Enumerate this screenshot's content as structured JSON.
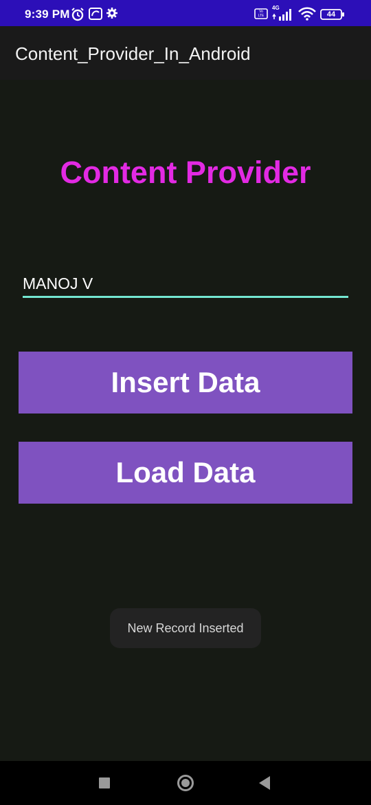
{
  "status_bar": {
    "time": "9:39 PM",
    "volte": "Vo LTE",
    "network": "4G",
    "battery": "44",
    "icons": [
      "alarm-icon",
      "hotstar-icon",
      "gear-icon",
      "volte-icon",
      "signal-icon",
      "wifi-icon",
      "battery-icon"
    ]
  },
  "app_bar": {
    "title": "Content_Provider_In_Android"
  },
  "main": {
    "heading": "Content Provider",
    "name_input_value": "MANOJ V",
    "insert_button_label": "Insert Data",
    "load_button_label": "Load Data"
  },
  "toast": {
    "message": "New Record Inserted"
  },
  "navigation_bar": {
    "buttons": [
      "recents-icon",
      "home-icon",
      "back-icon"
    ]
  },
  "colors": {
    "status_bar": "#2c0fb8",
    "app_bar": "#1a1a1a",
    "background": "#161a14",
    "heading": "#e22ae3",
    "input_underline": "#74e7d1",
    "button": "#7f52c0",
    "toast": "#232323"
  }
}
